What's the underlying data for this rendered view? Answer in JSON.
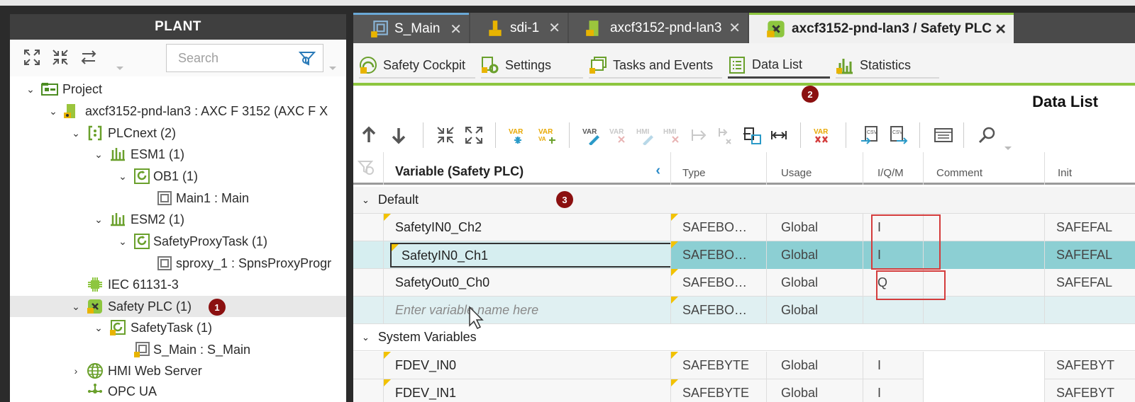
{
  "plant": {
    "title": "PLANT",
    "search_placeholder": "Search",
    "tree": [
      {
        "label": "Project"
      },
      {
        "label": "axcf3152-pnd-lan3 : AXC F 3152 (AXC F X"
      },
      {
        "label": "PLCnext (2)"
      },
      {
        "label": "ESM1 (1)"
      },
      {
        "label": "OB1 (1)"
      },
      {
        "label": "Main1 : Main"
      },
      {
        "label": "ESM2 (1)"
      },
      {
        "label": "SafetyProxyTask (1)"
      },
      {
        "label": "sproxy_1 : SpnsProxyProgr"
      },
      {
        "label": "IEC 61131-3"
      },
      {
        "label": "Safety PLC (1)"
      },
      {
        "label": "SafetyTask (1)"
      },
      {
        "label": "S_Main : S_Main"
      },
      {
        "label": "HMI Web Server"
      },
      {
        "label": "OPC UA"
      }
    ]
  },
  "badges": [
    "1",
    "2",
    "3"
  ],
  "tabs": [
    {
      "label": "S_Main"
    },
    {
      "label": "sdi-1"
    },
    {
      "label": "axcf3152-pnd-lan3"
    },
    {
      "label": "axcf3152-pnd-lan3 / Safety PLC"
    }
  ],
  "close_glyph": "✕",
  "subtabs": [
    {
      "label": "Safety Cockpit"
    },
    {
      "label": "Settings"
    },
    {
      "label": "Tasks and Events"
    },
    {
      "label": "Data List"
    },
    {
      "label": "Statistics"
    }
  ],
  "page_title": "Data List",
  "grid": {
    "columns": {
      "variable": "Variable (Safety PLC)",
      "type": "Type",
      "usage": "Usage",
      "iqm": "I/Q/M",
      "comment": "Comment",
      "init": "Init"
    },
    "groups": [
      {
        "name": "Default"
      },
      {
        "name": "System Variables"
      }
    ],
    "rows": [
      {
        "name": "SafetyIN0_Ch2",
        "type": "SAFEBO…",
        "usage": "Global",
        "iqm": "I",
        "comment": "",
        "init": "SAFEFAL"
      },
      {
        "name": "SafetyIN0_Ch1",
        "type": "SAFEBO…",
        "usage": "Global",
        "iqm": "I",
        "comment": "",
        "init": "SAFEFAL"
      },
      {
        "name": "SafetyOut0_Ch0",
        "type": "SAFEBO…",
        "usage": "Global",
        "iqm": "Q",
        "comment": "",
        "init": "SAFEFAL"
      },
      {
        "name": "",
        "placeholder": "Enter variable name here",
        "type": "SAFEBO…",
        "usage": "Global",
        "iqm": "",
        "comment": "",
        "init": ""
      },
      {
        "name": "FDEV_IN0",
        "type": "SAFEBYTE",
        "usage": "Global",
        "iqm": "I",
        "comment": "",
        "init": "SAFEBYT"
      },
      {
        "name": "FDEV_IN1",
        "type": "SAFEBYTE",
        "usage": "Global",
        "iqm": "I",
        "comment": "",
        "init": "SAFEBYT"
      }
    ]
  },
  "colors": {
    "accent_green": "#8dc63f",
    "badge_red": "#8b1010",
    "highlight_box": "#d43c3c",
    "selection_teal": "#8ccfd3"
  }
}
